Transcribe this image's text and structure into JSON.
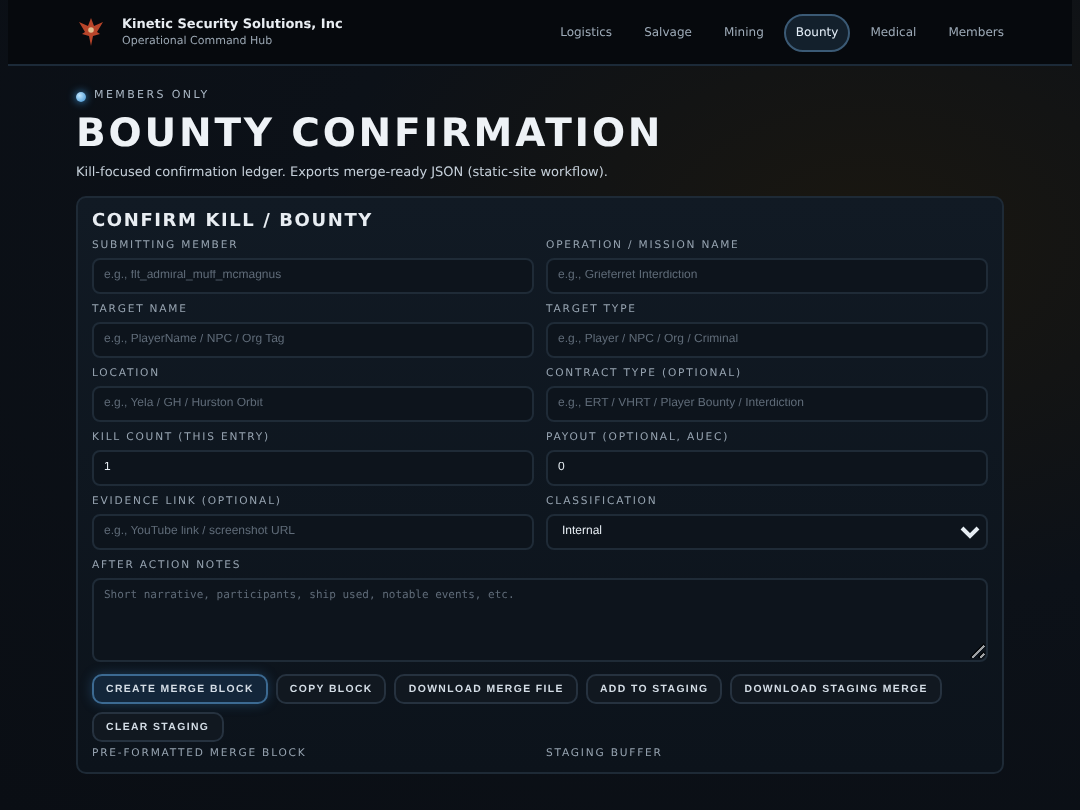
{
  "header": {
    "org_name": "Kinetic Security Solutions, Inc",
    "org_subtitle": "Operational Command Hub"
  },
  "nav": [
    {
      "label": "Logistics",
      "selected": false
    },
    {
      "label": "Salvage",
      "selected": false
    },
    {
      "label": "Mining",
      "selected": false
    },
    {
      "label": "Bounty",
      "selected": true
    },
    {
      "label": "Medical",
      "selected": false
    },
    {
      "label": "Members",
      "selected": false
    }
  ],
  "badge": "MEMBERS ONLY",
  "title": "BOUNTY CONFIRMATION",
  "subtitle": "Kill-focused confirmation ledger. Exports merge-ready JSON (static-site workflow).",
  "card": {
    "title": "CONFIRM KILL / BOUNTY",
    "fields": [
      {
        "label": "SUBMITTING MEMBER",
        "kind": "text",
        "placeholder": "e.g., flt_admiral_muff_mcmagnus"
      },
      {
        "label": "OPERATION / MISSION NAME",
        "kind": "text",
        "placeholder": "e.g., Grieferret Interdiction"
      },
      {
        "label": "TARGET NAME",
        "kind": "text",
        "placeholder": "e.g., PlayerName / NPC / Org Tag"
      },
      {
        "label": "TARGET TYPE",
        "kind": "text",
        "placeholder": "e.g., Player / NPC / Org / Criminal"
      },
      {
        "label": "LOCATION",
        "kind": "text",
        "placeholder": "e.g., Yela / GH / Hurston Orbit"
      },
      {
        "label": "CONTRACT TYPE (OPTIONAL)",
        "kind": "text",
        "placeholder": "e.g., ERT / VHRT / Player Bounty / Interdiction"
      },
      {
        "label": "KILL COUNT (THIS ENTRY)",
        "kind": "number",
        "value": "1"
      },
      {
        "label": "PAYOUT (OPTIONAL, AUEC)",
        "kind": "number",
        "value": "0"
      },
      {
        "label": "EVIDENCE LINK (OPTIONAL)",
        "kind": "text",
        "placeholder": "e.g., YouTube link / screenshot URL"
      },
      {
        "label": "CLASSIFICATION",
        "kind": "select",
        "value": "Internal"
      }
    ],
    "notes": {
      "label": "AFTER ACTION NOTES",
      "placeholder": "Short narrative, participants, ship used, notable events, etc."
    },
    "buttons": [
      {
        "label": "CREATE MERGE BLOCK",
        "primary": true
      },
      {
        "label": "COPY BLOCK",
        "primary": false
      },
      {
        "label": "DOWNLOAD MERGE FILE",
        "primary": false
      },
      {
        "label": "ADD TO STAGING",
        "primary": false
      },
      {
        "label": "DOWNLOAD STAGING MERGE",
        "primary": false
      },
      {
        "label": "CLEAR STAGING",
        "primary": false
      }
    ],
    "output_labels": [
      "PRE-FORMATTED MERGE BLOCK",
      "STAGING BUFFER"
    ]
  }
}
